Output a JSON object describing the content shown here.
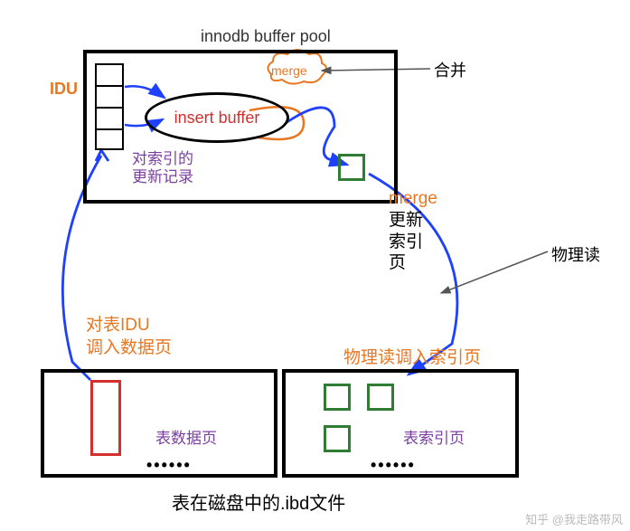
{
  "pool_title": "innodb buffer pool",
  "idu_label": "IDU",
  "insert_buffer": "insert buffer",
  "merge_cloud": "merge",
  "idx_update_record": "对索引的\n更新记录",
  "merge_update_idx": {
    "en": "merge",
    "cn": "更新\n索引\n页"
  },
  "anno_merge": "合并",
  "anno_physical": "物理读",
  "disk_idu_label": "对表IDU\n调入数据页",
  "phys_read_label": "物理读调入索引页",
  "data_page": "表数据页",
  "idx_page": "表索引页",
  "dots": "••••••",
  "caption": "表在磁盘中的.ibd文件",
  "watermark": "知乎 @我走路带风",
  "colors": {
    "orange": "#E87722",
    "red": "#D32F2F",
    "green": "#2E7D32",
    "purple": "#7B3FA0",
    "blue": "#1E40FF"
  }
}
